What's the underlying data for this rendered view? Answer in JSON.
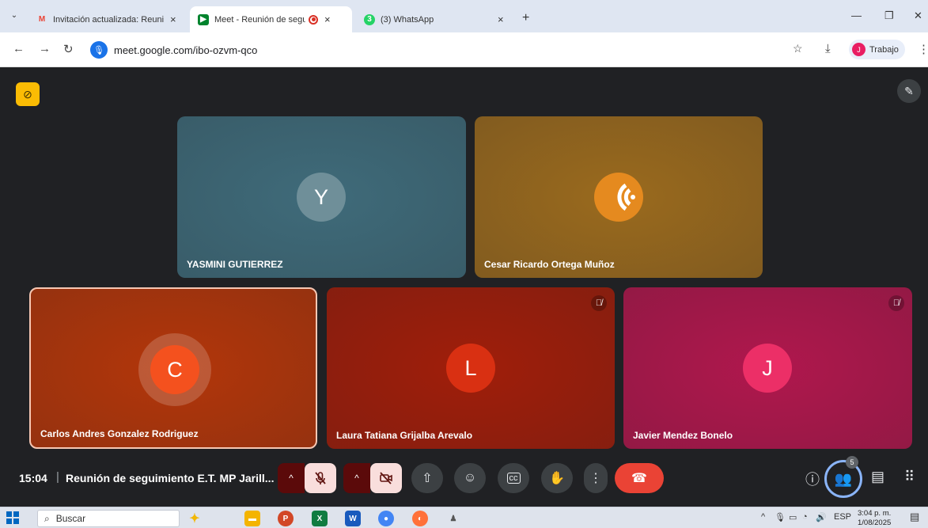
{
  "browser": {
    "tabs": [
      {
        "label": "Invitación actualizada: Reunión",
        "favicon": "gmail-icon",
        "active": false
      },
      {
        "label": "Meet - Reunión de seguimi",
        "favicon": "meet-icon",
        "active": true
      },
      {
        "label": "(3) WhatsApp",
        "favicon": "whatsapp-icon",
        "active": false
      }
    ],
    "url": "meet.google.com/ibo-ozvm-qco",
    "profile_name": "Trabajo",
    "profile_initial": "J"
  },
  "participants": [
    {
      "name": "YASMINI GUTIERREZ",
      "initial": "Y",
      "bg": "#3f6b7a",
      "avatar_bg": "#6f8f99",
      "muted": false
    },
    {
      "name": "Cesar Ricardo Ortega Muñoz",
      "initial": "",
      "bg": "#9a6a1e",
      "avatar_bg": "#e58a1f",
      "muted": false
    },
    {
      "name": "Carlos Andres Gonzalez Rodriguez",
      "initial": "C",
      "bg": "#b3360a",
      "avatar_bg": "#f4511e",
      "muted": false,
      "speaking": true
    },
    {
      "name": "Laura Tatiana Grijalba Arevalo",
      "initial": "L",
      "bg": "#a01e0a",
      "avatar_bg": "#d93012",
      "muted": true
    },
    {
      "name": "Javier Mendez Bonelo",
      "initial": "J",
      "bg": "#b0174d",
      "avatar_bg": "#ec2f67",
      "muted": true
    }
  ],
  "controls": {
    "time": "15:04",
    "separator": "|",
    "meeting_title": "Reunión de seguimiento E.T. MP Jarill...",
    "people_count": "5"
  },
  "taskbar": {
    "search_placeholder": "Buscar",
    "language": "ESP",
    "time": "3:04 p. m.",
    "date": "1/08/2025"
  }
}
